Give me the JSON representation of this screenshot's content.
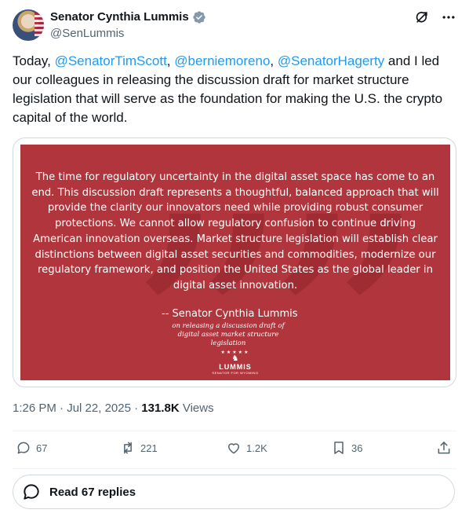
{
  "author": {
    "name": "Senator Cynthia Lummis",
    "handle": "@SenLummis"
  },
  "tweet": {
    "text_before": "Today, ",
    "mention_1": "@SenatorTimScott",
    "sep_1": ", ",
    "mention_2": "@berniemoreno",
    "sep_2": ", ",
    "mention_3": "@SenatorHagerty",
    "text_after": " and I led our colleagues in releasing the discussion draft for market structure legislation that will serve as the foundation for making the U.S. the crypto capital of the world."
  },
  "media": {
    "quote": "The time for regulatory uncertainty in the digital asset space has come to an end. This discussion draft represents a thoughtful, balanced approach that will provide the clarity our innovators need while providing robust consumer protections. We cannot allow regulatory confusion to continue driving American innovation overseas. Market structure legislation will establish clear distinctions between digital asset securities and commodities, modernize our regulatory framework, and position the United States as the global leader in digital asset innovation.",
    "attribution": "-- Senator Cynthia Lummis",
    "attribution_sub": "on releasing a discussion draft of digital asset market structure legislation",
    "logo_word": "LUMMIS",
    "logo_tag": "SENATOR FOR WYOMING",
    "panel_color": "#b0353c"
  },
  "meta": {
    "time": "1:26 PM",
    "dot": " · ",
    "date": "Jul 22, 2025",
    "dot2": " · ",
    "views_count": "131.8K",
    "views_label": " Views"
  },
  "actions": {
    "replies": "67",
    "reposts": "221",
    "likes": "1.2K",
    "bookmarks": "36"
  },
  "read_replies": "Read 67 replies",
  "colors": {
    "accent": "#1d9bf0",
    "text": "#0f1419",
    "muted": "#536471"
  },
  "icons": [
    "verified-badge-icon",
    "grok-icon",
    "more-icon",
    "reply-icon",
    "repost-icon",
    "like-icon",
    "bookmark-icon",
    "share-icon",
    "replies-bubble-icon"
  ]
}
